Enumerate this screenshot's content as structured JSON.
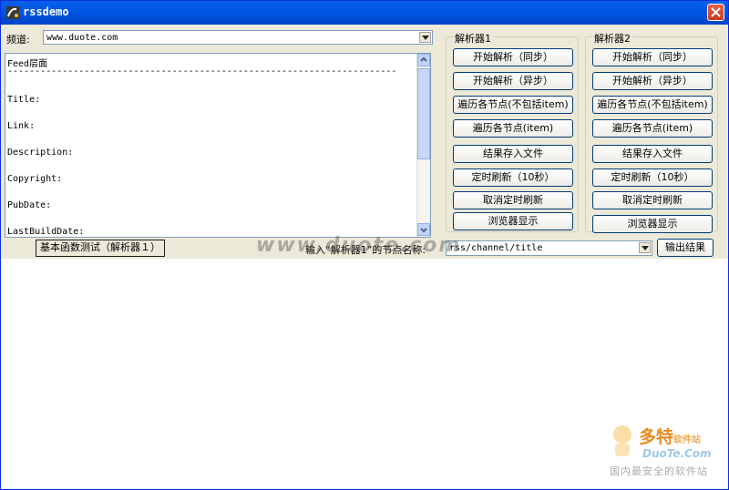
{
  "window": {
    "title": "rssdemo"
  },
  "channel": {
    "label": "频道:",
    "value": "www.duote.com"
  },
  "output": {
    "lines": [
      "Feed层面",
      "-----------------------------------------------------------------------",
      "Title:",
      "Link:",
      "Description:",
      "Copyright:",
      "PubDate:",
      "LastBuildDate:"
    ]
  },
  "parser1": {
    "title": "解析器1",
    "buttons": [
      "开始解析（同步）",
      "开始解析（异步）",
      "遍历各节点(不包括item)",
      "遍历各节点(item)",
      "结果存入文件",
      "定时刷新（10秒）",
      "取消定时刷新",
      "浏览器显示"
    ]
  },
  "parser2": {
    "title": "解析器2",
    "buttons": [
      "开始解析（同步）",
      "开始解析（异步）",
      "遍历各节点(不包括item)",
      "遍历各节点(item)",
      "结果存入文件",
      "定时刷新（10秒）",
      "取消定时刷新",
      "浏览器显示"
    ]
  },
  "bottom": {
    "basic_test_label": "基本函数测试（解析器１）",
    "node_label": "输入“解析器1”的节点名称:",
    "node_value": "rss/channel/title",
    "output_label": "输出结果"
  },
  "watermark": {
    "text": "www.duote.com"
  },
  "logo": {
    "brand": "多特",
    "brand_sub": "软件站",
    "url": "DuoTe.Com",
    "slogan": "国内最安全的软件站"
  }
}
